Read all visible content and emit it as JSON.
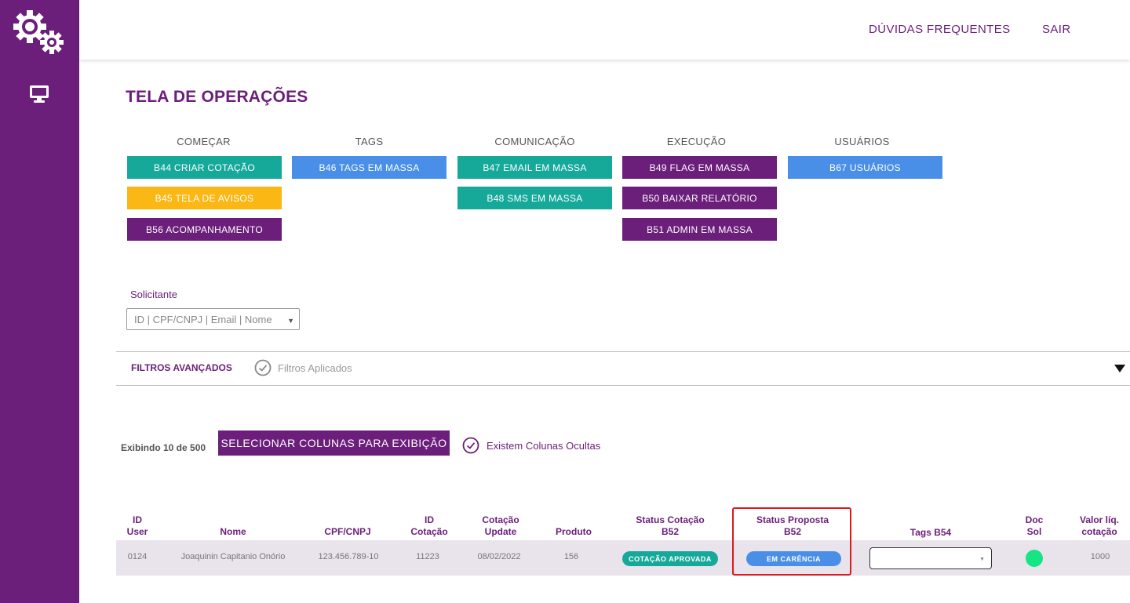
{
  "header": {
    "faq_label": "DÚVIDAS FREQUENTES",
    "logout_label": "SAIR"
  },
  "sidebar": {
    "logo_icon": "gears-icon",
    "nav_icon": "monitor-icon"
  },
  "page": {
    "title": "TELA DE OPERAÇÕES"
  },
  "groups": {
    "comecar": {
      "title": "COMEÇAR",
      "buttons": [
        "B44  CRIAR COTAÇÃO",
        "B45 TELA DE AVISOS",
        "B56 ACOMPANHAMENTO"
      ]
    },
    "tags": {
      "title": "TAGS",
      "buttons": [
        "B46 TAGS EM MASSA"
      ]
    },
    "comunicacao": {
      "title": "COMUNICAÇÃO",
      "buttons": [
        "B47 EMAIL EM MASSA",
        "B48 SMS EM MASSA"
      ]
    },
    "execucao": {
      "title": "EXECUÇÃO",
      "buttons": [
        "B49 FLAG EM MASSA",
        "B50 BAIXAR RELATÓRIO",
        "B51 ADMIN EM MASSA"
      ]
    },
    "usuarios": {
      "title": "USUÁRIOS",
      "buttons": [
        "B67 USUÁRIOS"
      ]
    }
  },
  "solicitante": {
    "label": "Solicitante",
    "placeholder": "ID | CPF/CNPJ | Email | Nome"
  },
  "filters": {
    "title": "FILTROS AVANÇADOS",
    "applied_label": "Filtros Aplicados"
  },
  "table_controls": {
    "showing": "Exibindo 10 de 500",
    "select_columns_label": "SELECIONAR COLUNAS PARA EXIBIÇÃO",
    "hidden_columns_label": "Existem Colunas Ocultas"
  },
  "table": {
    "headers": {
      "id_user": [
        "ID",
        "User"
      ],
      "nome": "Nome",
      "cpf": "CPF/CNPJ",
      "id_cotacao": [
        "ID",
        "Cotação"
      ],
      "cotacao_update": [
        "Cotação",
        "Update"
      ],
      "produto": "Produto",
      "status_cotacao": [
        "Status Cotação",
        "B52"
      ],
      "status_proposta": [
        "Status Proposta",
        "B52"
      ],
      "tags": "Tags B54",
      "doc_sol": [
        "Doc",
        "Sol"
      ],
      "valor": [
        "Valor líq.",
        "cotação"
      ]
    },
    "rows": [
      {
        "id_user": "0124",
        "nome": "Joaquinin Capitanio Onório",
        "cpf": "123.456.789-10",
        "id_cotacao": "11223",
        "cotacao_update": "08/02/2022",
        "produto": "156",
        "status_cotacao": "COTAÇÃO APROVADA",
        "status_proposta": "EM CARÊNCIA",
        "tags_value": "",
        "valor": "1000"
      }
    ]
  },
  "colors": {
    "brand_purple": "#6b1e7a",
    "teal": "#16a99a",
    "blue": "#4a8fe7",
    "yellow": "#fbb713",
    "doc_ok_green": "#16e585",
    "highlight_red": "#e0171d"
  }
}
